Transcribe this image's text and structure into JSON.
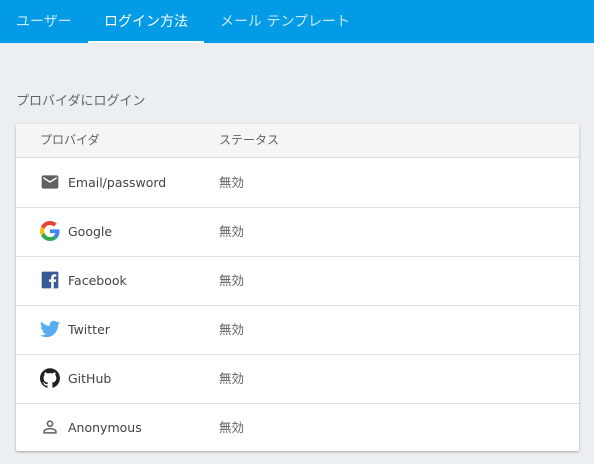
{
  "tabs": [
    {
      "label": "ユーザー",
      "active": false
    },
    {
      "label": "ログイン方法",
      "active": true
    },
    {
      "label": "メール テンプレート",
      "active": false
    }
  ],
  "section": {
    "title": "プロバイダにログイン"
  },
  "table": {
    "headers": [
      "プロバイダ",
      "ステータス"
    ],
    "rows": [
      {
        "icon": "email-icon",
        "name": "Email/password",
        "status": "無効"
      },
      {
        "icon": "google-icon",
        "name": "Google",
        "status": "無効"
      },
      {
        "icon": "facebook-icon",
        "name": "Facebook",
        "status": "無効"
      },
      {
        "icon": "twitter-icon",
        "name": "Twitter",
        "status": "無効"
      },
      {
        "icon": "github-icon",
        "name": "GitHub",
        "status": "無効"
      },
      {
        "icon": "person-icon",
        "name": "Anonymous",
        "status": "無効"
      }
    ]
  },
  "colors": {
    "app_bar": "#039be5",
    "background": "#eceff1",
    "card": "#ffffff",
    "facebook": "#3b5998",
    "twitter": "#55acee"
  }
}
